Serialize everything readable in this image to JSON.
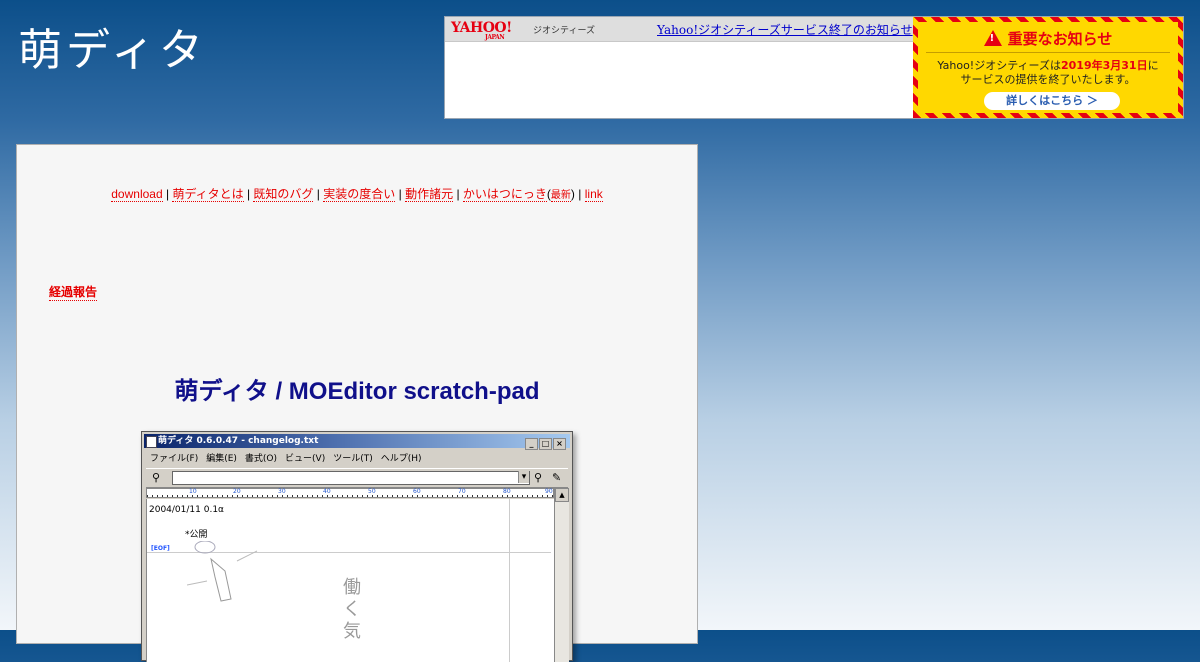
{
  "site": {
    "logo": "萌ディタ"
  },
  "yahoo_banner": {
    "logo": "YAHOO!",
    "logo_sub": "JAPAN",
    "service": "ジオシティーズ",
    "link": "Yahoo!ジオシティーズサービス終了のお知らせ",
    "notice_title": "重要なお知らせ",
    "notice_line1_a": "Yahoo!ジオシティーズは",
    "notice_line1_date": "2019年3月31日",
    "notice_line1_b": "に",
    "notice_line2": "サービスの提供を終了いたします。",
    "notice_button": "詳しくはこちら ＞"
  },
  "nav": {
    "items": [
      "download",
      "萌ディタとは",
      "既知のバグ",
      "実装の度合い",
      "動作諸元",
      "かいはつにっき"
    ],
    "diary_sub": "最新",
    "link": "link",
    "sep": "|"
  },
  "report": "経過報告",
  "heading": "萌ディタ / MOEditor scratch-pad",
  "app_window": {
    "title": "萌ディタ 0.6.0.47 - changelog.txt",
    "controls": [
      "_",
      "□",
      "×"
    ],
    "menu": [
      "ファイル(F)",
      "編集(E)",
      "書式(O)",
      "ビュー(V)",
      "ツール(T)",
      "ヘルプ(H)"
    ],
    "ruler_marks": [
      "10",
      "20",
      "30",
      "40",
      "50",
      "60",
      "70",
      "80",
      "90"
    ],
    "line1": "2004/01/11 0.1α",
    "line2": "*公開",
    "eof": "[EOF]",
    "handwriting": "働く気"
  },
  "colors": {
    "link_red": "#e60000",
    "heading_navy": "#10108a",
    "yahoo_red": "#e60012",
    "notice_yellow": "#ffd800"
  }
}
